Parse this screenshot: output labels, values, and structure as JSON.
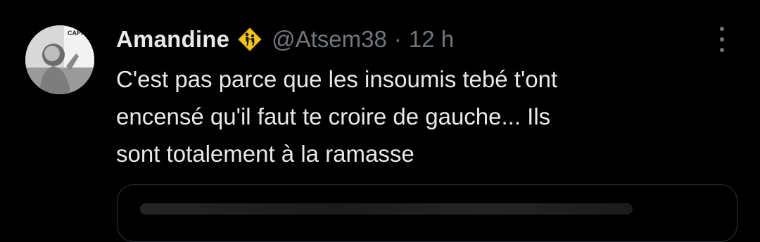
{
  "tweet": {
    "author_name": "Amandine",
    "badge_icon": "children-crossing-icon",
    "handle": "@Atsem38",
    "separator": "·",
    "time": "12 h",
    "text_lines": [
      "C'est pas parce que les insoumis tebé t'ont",
      "encensé qu'il faut te croire de gauche... Ils",
      "sont totalement à la ramasse"
    ],
    "avatar_text": "CAPITOLE"
  },
  "colors": {
    "background": "#000000",
    "primary_text": "#e7e9ea",
    "secondary_text": "#71767b",
    "border": "#2f3336",
    "badge_yellow": "#f5c518"
  }
}
